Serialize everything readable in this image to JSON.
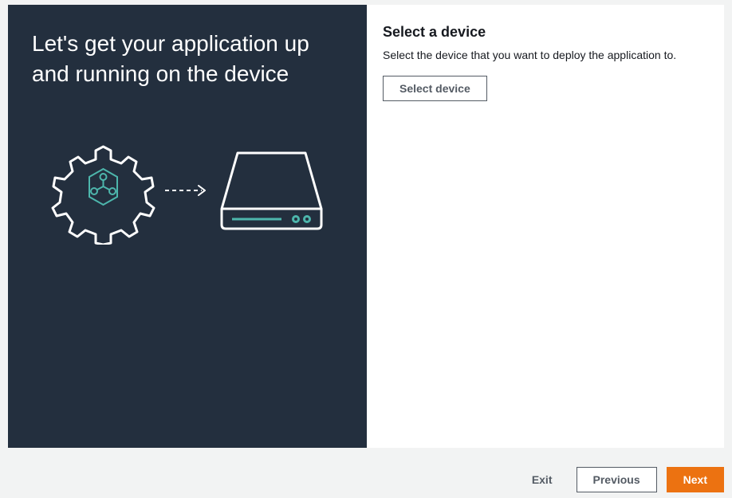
{
  "left": {
    "heading": "Let's get your application up and running on the device"
  },
  "right": {
    "heading": "Select a device",
    "description": "Select the device that you want to deploy the application to.",
    "select_device_label": "Select device"
  },
  "footer": {
    "exit_label": "Exit",
    "previous_label": "Previous",
    "next_label": "Next"
  }
}
